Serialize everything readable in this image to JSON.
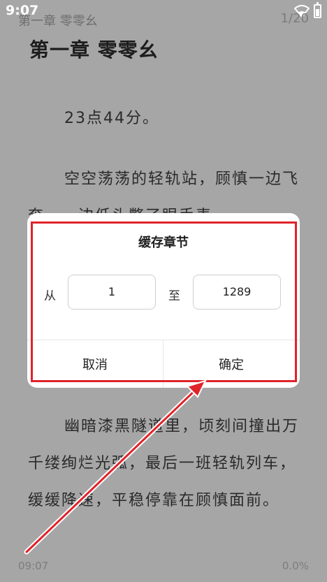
{
  "status_bar": {
    "time": "9:07"
  },
  "reader": {
    "header": "第一章 零零幺",
    "page_count": "1/20",
    "chapter_title": "第一章 零零幺",
    "paragraphs": [
      "23点44分。",
      "空空荡荡的轻轨站，顾慎一边飞奔，一边低头瞥了眼手表。",
      "幽暗漆黑隧道里，顷刻间撞出万千缕绚烂光弧，最后一班轻轨列车，缓缓降速，平稳停靠在顾慎面前。"
    ],
    "footer_time": "09:07",
    "footer_progress": "0.0%"
  },
  "dialog": {
    "title": "缓存章节",
    "from_label": "从",
    "from_value": "1",
    "to_label": "至",
    "to_value": "1289",
    "cancel_label": "取消",
    "confirm_label": "确定"
  },
  "colors": {
    "overlay_bg": "#a6a6a6",
    "annotation": "#e0232a"
  }
}
